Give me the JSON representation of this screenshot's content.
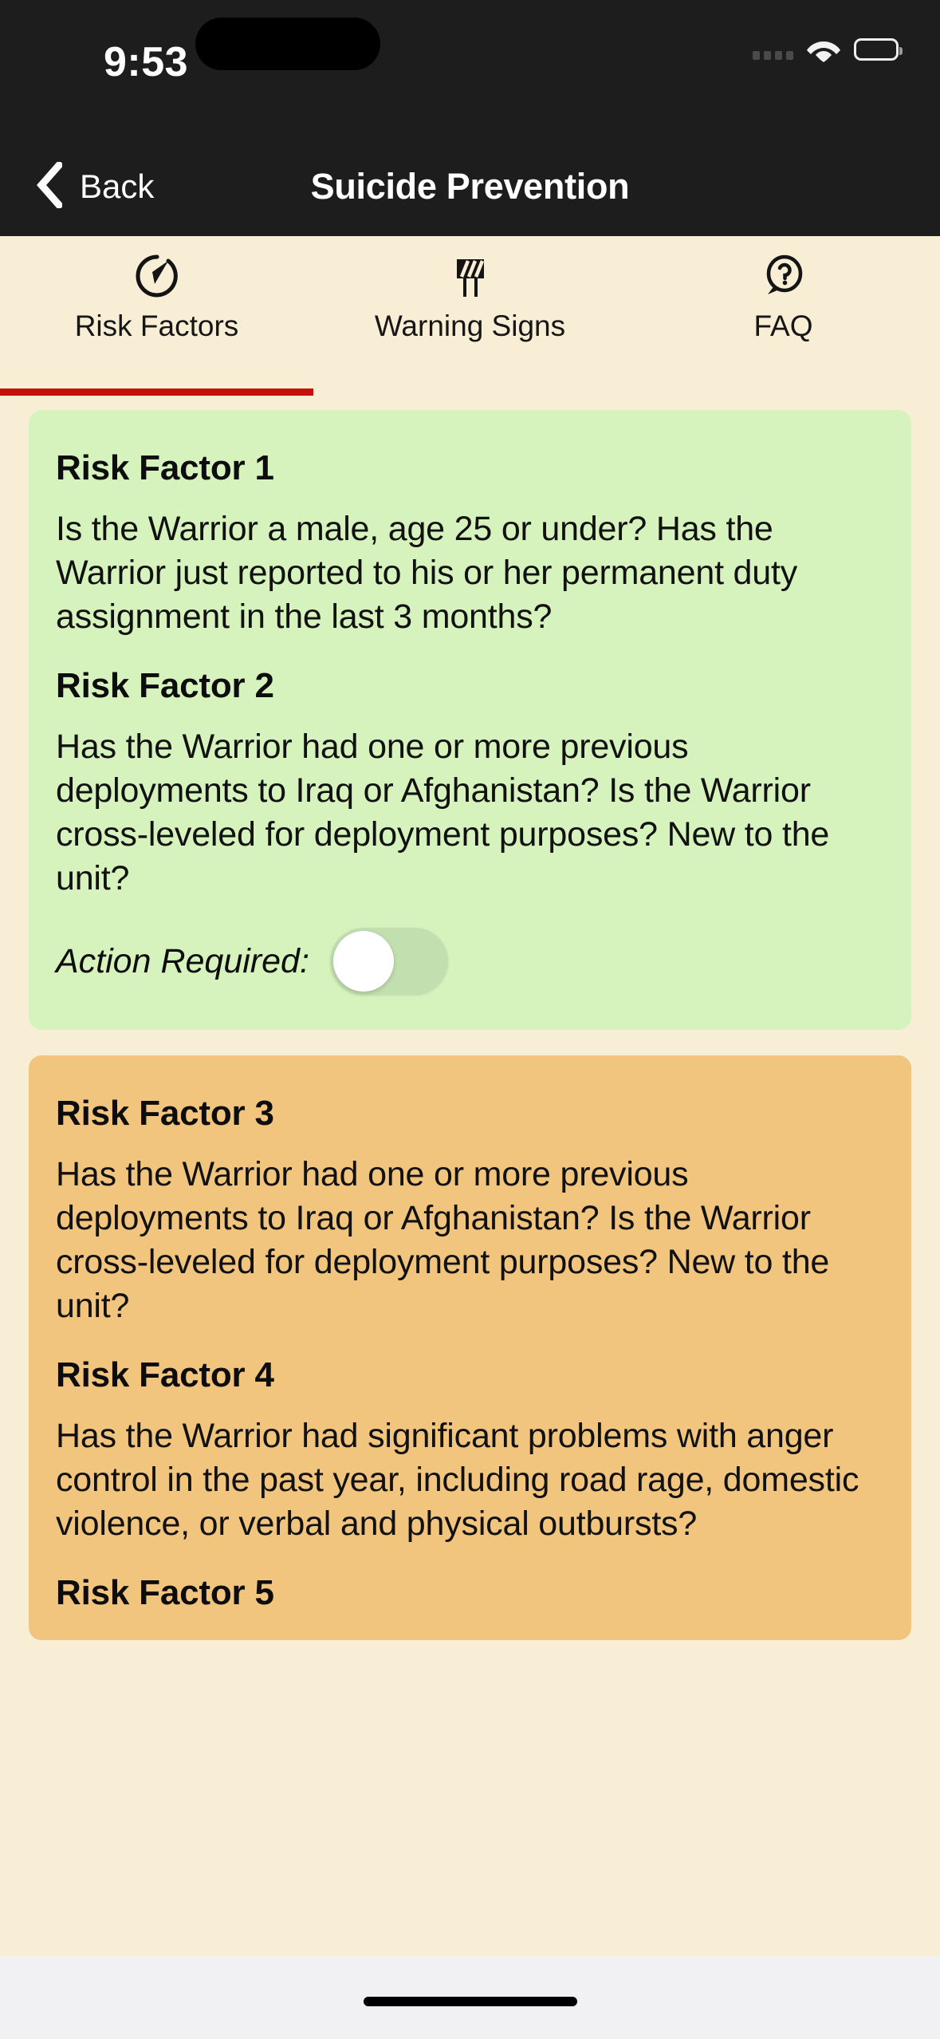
{
  "status_bar": {
    "time": "9:53",
    "cellular_icon": "cellular-bars-icon",
    "wifi_icon": "wifi-icon",
    "battery_icon": "battery-full-icon"
  },
  "nav_bar": {
    "back_label": "Back",
    "back_icon": "chevron-left-icon",
    "title": "Suicide Prevention"
  },
  "tabs": {
    "active_index": 0,
    "accent_color": "#c4110c",
    "items": [
      {
        "label": "Risk Factors",
        "icon": "gauge-icon"
      },
      {
        "label": "Warning Signs",
        "icon": "road-barrier-icon"
      },
      {
        "label": "FAQ",
        "icon": "question-speech-bubble-icon"
      }
    ]
  },
  "cards": [
    {
      "color": "#d7f3bd",
      "factors": [
        {
          "heading": "Risk Factor 1",
          "body": "Is the Warrior a male, age 25 or under? Has the Warrior just reported to his or her permanent duty assignment in the last 3 months?"
        },
        {
          "heading": "Risk Factor 2",
          "body": "Has the Warrior had one or more previous deployments to Iraq or Afghanistan? Is the Warrior cross-leveled for deployment purposes? New to the unit?"
        }
      ],
      "action": {
        "label": "Action Required:",
        "toggle_on": false
      }
    },
    {
      "color": "#f2c57e",
      "factors": [
        {
          "heading": "Risk Factor 3",
          "body": "Has the Warrior had one or more previous deployments to Iraq or Afghanistan? Is the Warrior cross-leveled for deployment purposes? New to the unit?"
        },
        {
          "heading": "Risk Factor 4",
          "body": "Has the Warrior had significant problems with anger control in the past year, including road rage, domestic violence, or verbal and physical outbursts?"
        },
        {
          "heading": "Risk Factor 5",
          "body": ""
        }
      ]
    }
  ],
  "home_indicator": "home-indicator"
}
